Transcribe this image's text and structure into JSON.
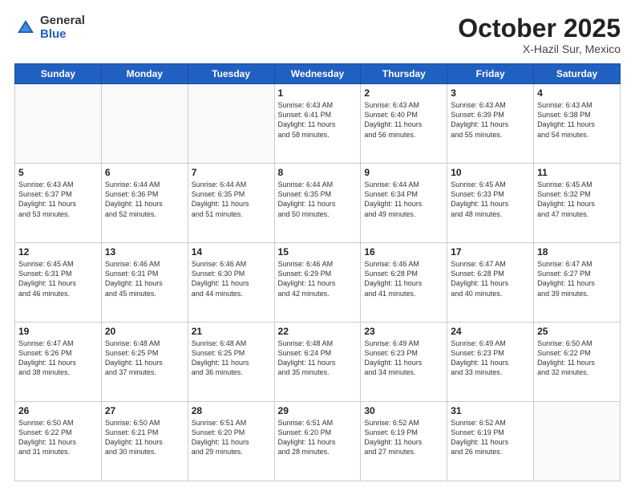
{
  "logo": {
    "general": "General",
    "blue": "Blue"
  },
  "title": "October 2025",
  "subtitle": "X-Hazil Sur, Mexico",
  "weekdays": [
    "Sunday",
    "Monday",
    "Tuesday",
    "Wednesday",
    "Thursday",
    "Friday",
    "Saturday"
  ],
  "days": [
    {
      "num": "",
      "info": ""
    },
    {
      "num": "",
      "info": ""
    },
    {
      "num": "",
      "info": ""
    },
    {
      "num": "1",
      "info": "Sunrise: 6:43 AM\nSunset: 6:41 PM\nDaylight: 11 hours\nand 58 minutes."
    },
    {
      "num": "2",
      "info": "Sunrise: 6:43 AM\nSunset: 6:40 PM\nDaylight: 11 hours\nand 56 minutes."
    },
    {
      "num": "3",
      "info": "Sunrise: 6:43 AM\nSunset: 6:39 PM\nDaylight: 11 hours\nand 55 minutes."
    },
    {
      "num": "4",
      "info": "Sunrise: 6:43 AM\nSunset: 6:38 PM\nDaylight: 11 hours\nand 54 minutes."
    },
    {
      "num": "5",
      "info": "Sunrise: 6:43 AM\nSunset: 6:37 PM\nDaylight: 11 hours\nand 53 minutes."
    },
    {
      "num": "6",
      "info": "Sunrise: 6:44 AM\nSunset: 6:36 PM\nDaylight: 11 hours\nand 52 minutes."
    },
    {
      "num": "7",
      "info": "Sunrise: 6:44 AM\nSunset: 6:35 PM\nDaylight: 11 hours\nand 51 minutes."
    },
    {
      "num": "8",
      "info": "Sunrise: 6:44 AM\nSunset: 6:35 PM\nDaylight: 11 hours\nand 50 minutes."
    },
    {
      "num": "9",
      "info": "Sunrise: 6:44 AM\nSunset: 6:34 PM\nDaylight: 11 hours\nand 49 minutes."
    },
    {
      "num": "10",
      "info": "Sunrise: 6:45 AM\nSunset: 6:33 PM\nDaylight: 11 hours\nand 48 minutes."
    },
    {
      "num": "11",
      "info": "Sunrise: 6:45 AM\nSunset: 6:32 PM\nDaylight: 11 hours\nand 47 minutes."
    },
    {
      "num": "12",
      "info": "Sunrise: 6:45 AM\nSunset: 6:31 PM\nDaylight: 11 hours\nand 46 minutes."
    },
    {
      "num": "13",
      "info": "Sunrise: 6:46 AM\nSunset: 6:31 PM\nDaylight: 11 hours\nand 45 minutes."
    },
    {
      "num": "14",
      "info": "Sunrise: 6:46 AM\nSunset: 6:30 PM\nDaylight: 11 hours\nand 44 minutes."
    },
    {
      "num": "15",
      "info": "Sunrise: 6:46 AM\nSunset: 6:29 PM\nDaylight: 11 hours\nand 42 minutes."
    },
    {
      "num": "16",
      "info": "Sunrise: 6:46 AM\nSunset: 6:28 PM\nDaylight: 11 hours\nand 41 minutes."
    },
    {
      "num": "17",
      "info": "Sunrise: 6:47 AM\nSunset: 6:28 PM\nDaylight: 11 hours\nand 40 minutes."
    },
    {
      "num": "18",
      "info": "Sunrise: 6:47 AM\nSunset: 6:27 PM\nDaylight: 11 hours\nand 39 minutes."
    },
    {
      "num": "19",
      "info": "Sunrise: 6:47 AM\nSunset: 6:26 PM\nDaylight: 11 hours\nand 38 minutes."
    },
    {
      "num": "20",
      "info": "Sunrise: 6:48 AM\nSunset: 6:25 PM\nDaylight: 11 hours\nand 37 minutes."
    },
    {
      "num": "21",
      "info": "Sunrise: 6:48 AM\nSunset: 6:25 PM\nDaylight: 11 hours\nand 36 minutes."
    },
    {
      "num": "22",
      "info": "Sunrise: 6:48 AM\nSunset: 6:24 PM\nDaylight: 11 hours\nand 35 minutes."
    },
    {
      "num": "23",
      "info": "Sunrise: 6:49 AM\nSunset: 6:23 PM\nDaylight: 11 hours\nand 34 minutes."
    },
    {
      "num": "24",
      "info": "Sunrise: 6:49 AM\nSunset: 6:23 PM\nDaylight: 11 hours\nand 33 minutes."
    },
    {
      "num": "25",
      "info": "Sunrise: 6:50 AM\nSunset: 6:22 PM\nDaylight: 11 hours\nand 32 minutes."
    },
    {
      "num": "26",
      "info": "Sunrise: 6:50 AM\nSunset: 6:22 PM\nDaylight: 11 hours\nand 31 minutes."
    },
    {
      "num": "27",
      "info": "Sunrise: 6:50 AM\nSunset: 6:21 PM\nDaylight: 11 hours\nand 30 minutes."
    },
    {
      "num": "28",
      "info": "Sunrise: 6:51 AM\nSunset: 6:20 PM\nDaylight: 11 hours\nand 29 minutes."
    },
    {
      "num": "29",
      "info": "Sunrise: 6:51 AM\nSunset: 6:20 PM\nDaylight: 11 hours\nand 28 minutes."
    },
    {
      "num": "30",
      "info": "Sunrise: 6:52 AM\nSunset: 6:19 PM\nDaylight: 11 hours\nand 27 minutes."
    },
    {
      "num": "31",
      "info": "Sunrise: 6:52 AM\nSunset: 6:19 PM\nDaylight: 11 hours\nand 26 minutes."
    },
    {
      "num": "",
      "info": ""
    },
    {
      "num": "",
      "info": ""
    }
  ]
}
